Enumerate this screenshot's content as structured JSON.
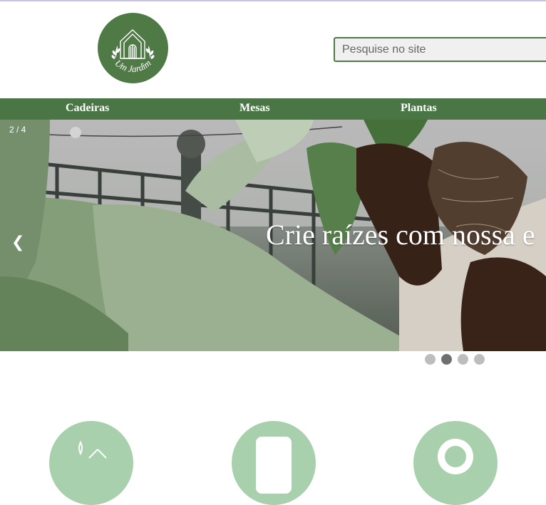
{
  "logo": {
    "text": "Um Jardim",
    "icon": "greenhouse-logo-icon"
  },
  "search": {
    "placeholder": "Pesquise no site"
  },
  "nav": {
    "items": [
      "Cadeiras",
      "Mesas",
      "Plantas"
    ]
  },
  "slider": {
    "counter": "2 / 4",
    "caption": "Crie raízes com nossa e",
    "prev_symbol": "❮",
    "total": 4,
    "active_index": 2
  },
  "features": {
    "icons": [
      "plant-icon",
      "phone-icon",
      "circle-icon"
    ]
  },
  "colors": {
    "brand": "#4a7645",
    "light_green": "#a8d0ad"
  }
}
